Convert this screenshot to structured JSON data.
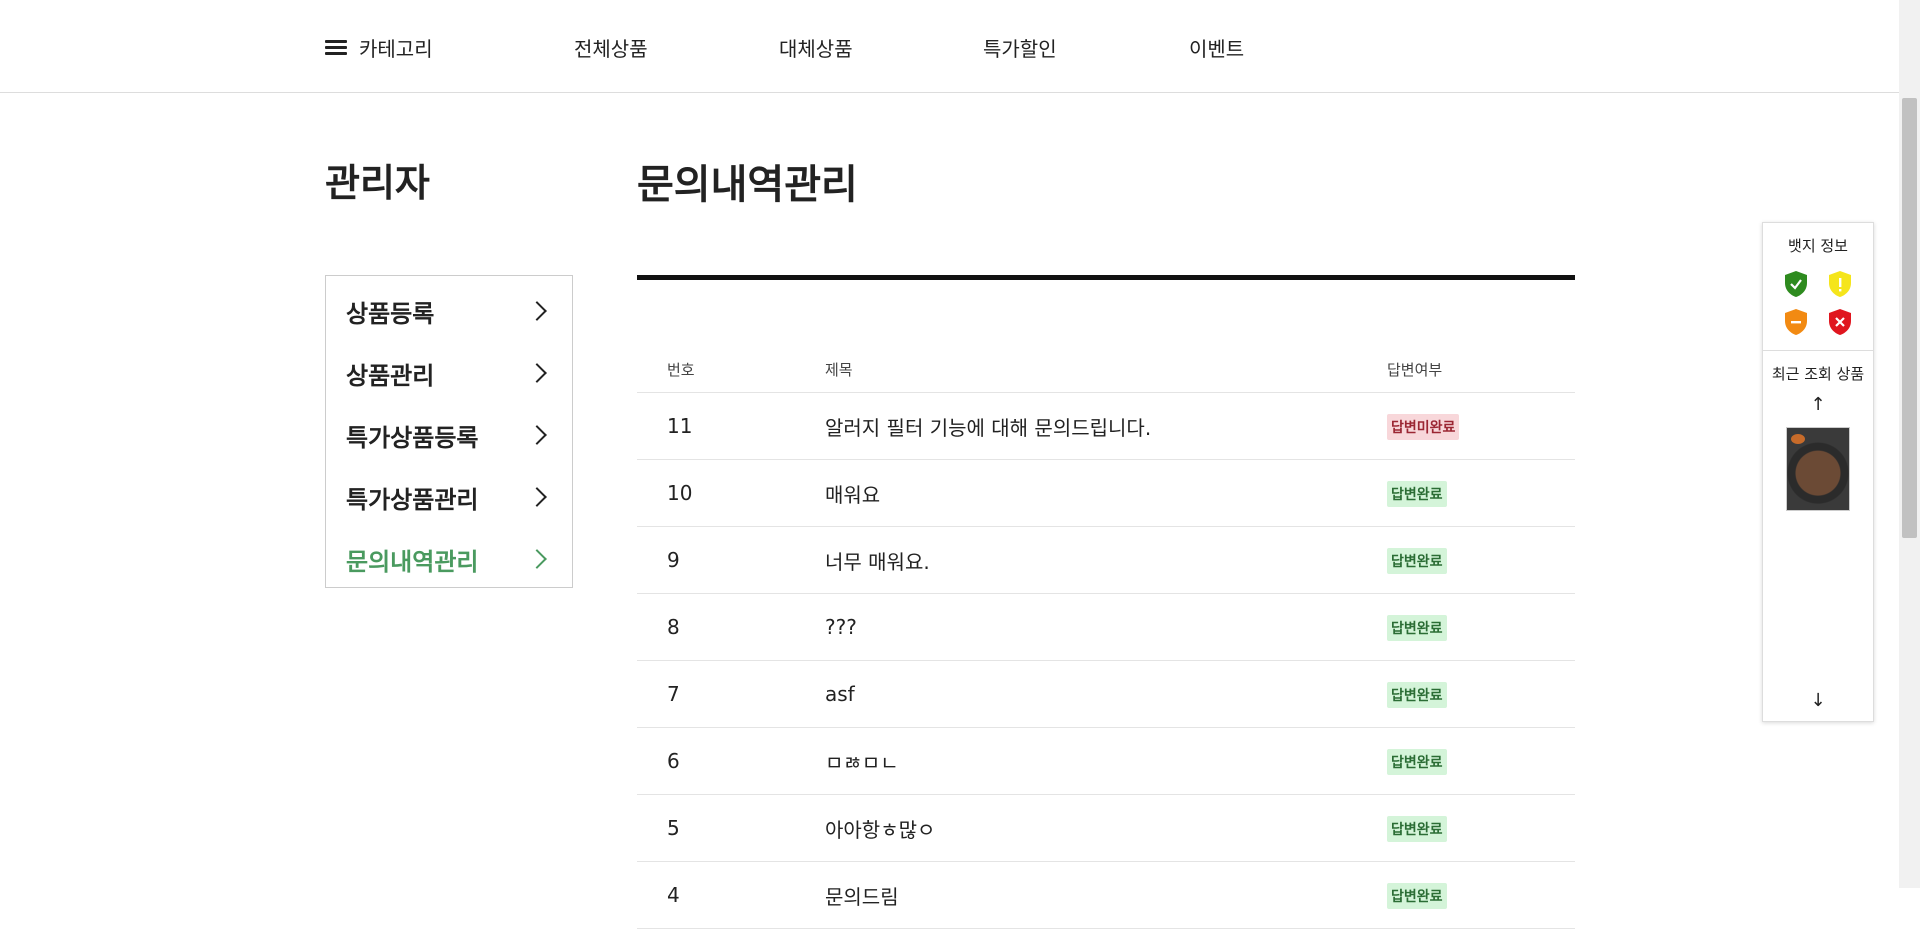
{
  "nav": {
    "category_label": "카테고리",
    "items": [
      "전체상품",
      "대체상품",
      "특가할인",
      "이벤트"
    ]
  },
  "sidebar": {
    "title": "관리자",
    "items": [
      {
        "label": "상품등록",
        "active": false
      },
      {
        "label": "상품관리",
        "active": false
      },
      {
        "label": "특가상품등록",
        "active": false
      },
      {
        "label": "특가상품관리",
        "active": false
      },
      {
        "label": "문의내역관리",
        "active": true
      }
    ]
  },
  "main": {
    "title": "문의내역관리",
    "columns": [
      "번호",
      "제목",
      "답변여부"
    ],
    "rows": [
      {
        "num": "11",
        "title": "알러지 필터 기능에 대해 문의드립니다.",
        "status": "답변미완료",
        "answered": false
      },
      {
        "num": "10",
        "title": "매워요",
        "status": "답변완료",
        "answered": true
      },
      {
        "num": "9",
        "title": "너무 매워요.",
        "status": "답변완료",
        "answered": true
      },
      {
        "num": "8",
        "title": "???",
        "status": "답변완료",
        "answered": true
      },
      {
        "num": "7",
        "title": "asf",
        "status": "답변완료",
        "answered": true
      },
      {
        "num": "6",
        "title": "ㅁㅀㅁㄴ",
        "status": "답변완료",
        "answered": true
      },
      {
        "num": "5",
        "title": "아아항ㅎ많ㅇ",
        "status": "답변완료",
        "answered": true
      },
      {
        "num": "4",
        "title": "문의드림",
        "status": "답변완료",
        "answered": true
      }
    ]
  },
  "float_panel": {
    "badge_title": "뱃지 정보",
    "badges": [
      {
        "icon": "green-shield-check-icon",
        "color": "#2e8b1f"
      },
      {
        "icon": "yellow-shield-exclamation-icon",
        "color": "#f5e51b"
      },
      {
        "icon": "orange-shield-minus-icon",
        "color": "#f28a12"
      },
      {
        "icon": "red-shield-x-icon",
        "color": "#e0161f"
      }
    ],
    "recent_title": "최근 조회 상품",
    "up_arrow": "↑",
    "down_arrow": "↓"
  },
  "colors": {
    "accent_green": "#4a9a5f",
    "badge_done_bg": "#d4f4d9",
    "badge_pending_bg": "#f8d7da"
  }
}
